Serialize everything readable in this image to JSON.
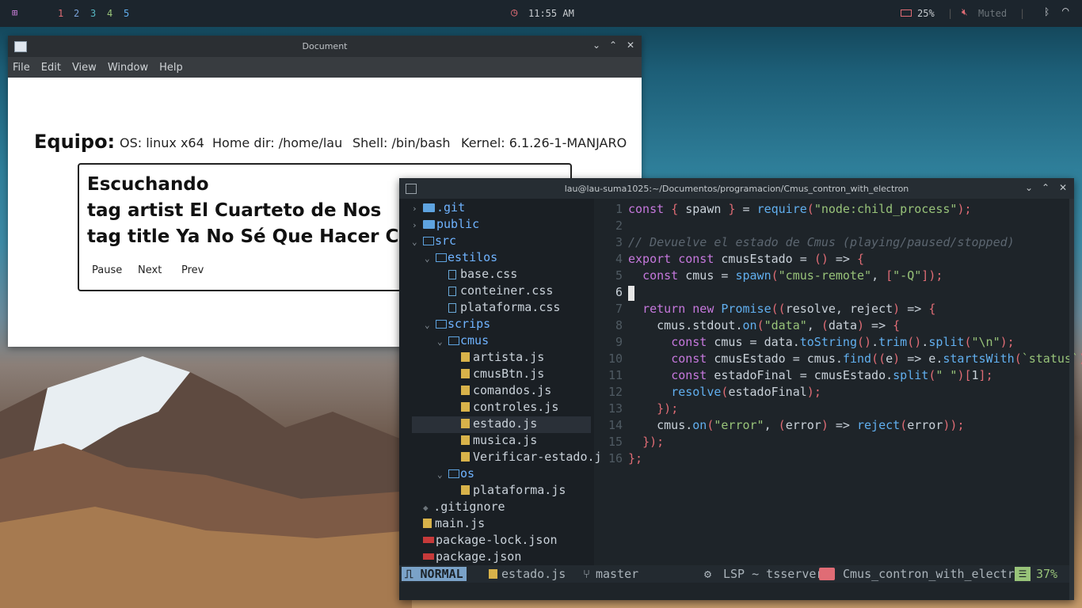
{
  "topbar": {
    "workspaces": [
      "1",
      "2",
      "3",
      "4",
      "5"
    ],
    "clock": "11:55 AM",
    "battery": "25%",
    "volume": "Muted"
  },
  "document": {
    "title": "Document",
    "menu": [
      "File",
      "Edit",
      "View",
      "Window",
      "Help"
    ],
    "equipo_label": "Equipo:",
    "os": "OS: linux x64",
    "home": "Home dir: /home/lau",
    "shell": "Shell: /bin/bash",
    "kernel": "Kernel: 6.1.26-1-MANJARO",
    "listening": "Escuchando",
    "artist": "tag artist El Cuarteto de Nos",
    "track_title": "tag title Ya No Sé Que Hacer Conmigo",
    "buttons": [
      "Pause",
      "Next",
      "Prev"
    ]
  },
  "terminal": {
    "title": "lau@lau-suma1025:~/Documentos/programacion/Cmus_contron_with_electron",
    "tree": [
      {
        "name": ".git",
        "type": "folder",
        "depth": 0,
        "arrow": "›"
      },
      {
        "name": "public",
        "type": "folder",
        "depth": 0,
        "arrow": "›"
      },
      {
        "name": "src",
        "type": "folder-open",
        "depth": 0,
        "arrow": "⌄"
      },
      {
        "name": "estilos",
        "type": "folder-open",
        "depth": 1,
        "arrow": "⌄"
      },
      {
        "name": "base.css",
        "type": "css",
        "depth": 2,
        "arrow": ""
      },
      {
        "name": "conteiner.css",
        "type": "css",
        "depth": 2,
        "arrow": ""
      },
      {
        "name": "plataforma.css",
        "type": "css",
        "depth": 2,
        "arrow": ""
      },
      {
        "name": "scrips",
        "type": "folder-open",
        "depth": 1,
        "arrow": "⌄"
      },
      {
        "name": "cmus",
        "type": "folder-open",
        "depth": 2,
        "arrow": "⌄"
      },
      {
        "name": "artista.js",
        "type": "js",
        "depth": 3,
        "arrow": ""
      },
      {
        "name": "cmusBtn.js",
        "type": "js",
        "depth": 3,
        "arrow": ""
      },
      {
        "name": "comandos.js",
        "type": "js",
        "depth": 3,
        "arrow": ""
      },
      {
        "name": "controles.js",
        "type": "js",
        "depth": 3,
        "arrow": ""
      },
      {
        "name": "estado.js",
        "type": "js",
        "depth": 3,
        "arrow": "",
        "selected": true
      },
      {
        "name": "musica.js",
        "type": "js",
        "depth": 3,
        "arrow": ""
      },
      {
        "name": "Verificar-estado.j",
        "type": "js",
        "depth": 3,
        "arrow": ""
      },
      {
        "name": "os",
        "type": "folder-open",
        "depth": 2,
        "arrow": "⌄"
      },
      {
        "name": "plataforma.js",
        "type": "js",
        "depth": 3,
        "arrow": ""
      },
      {
        "name": ".gitignore",
        "type": "git",
        "depth": 0,
        "arrow": ""
      },
      {
        "name": "main.js",
        "type": "js",
        "depth": 0,
        "arrow": ""
      },
      {
        "name": "package-lock.json",
        "type": "npm",
        "depth": 0,
        "arrow": ""
      },
      {
        "name": "package.json",
        "type": "npm",
        "depth": 0,
        "arrow": ""
      }
    ],
    "line_numbers": [
      "1",
      "2",
      "3",
      "4",
      "5",
      "6",
      "7",
      "8",
      "9",
      "10",
      "11",
      "12",
      "13",
      "14",
      "15",
      "16"
    ],
    "code": [
      "const { spawn } = require(\"node:child_process\");",
      "",
      "// Devuelve el estado de Cmus (playing/paused/stopped)",
      "export const cmusEstado = () => {",
      "  const cmus = spawn(\"cmus-remote\", [\"-Q\"]);",
      "",
      "  return new Promise((resolve, reject) => {",
      "    cmus.stdout.on(\"data\", (data) => {",
      "      const cmus = data.toString().trim().split(\"\\n\");",
      "      const cmusEstado = cmus.find((e) => e.startsWith(`status`));",
      "      const estadoFinal = cmusEstado.split(\" \")[1];",
      "      resolve(estadoFinal);",
      "    });",
      "    cmus.on(\"error\", (error) => reject(error));",
      "  });",
      "};"
    ],
    "status": {
      "mode": "NORMAL",
      "file": "estado.js",
      "branch": "master",
      "lsp": "LSP ~ tsserver",
      "project": "Cmus_contron_with_electron",
      "percent": "37%"
    }
  }
}
